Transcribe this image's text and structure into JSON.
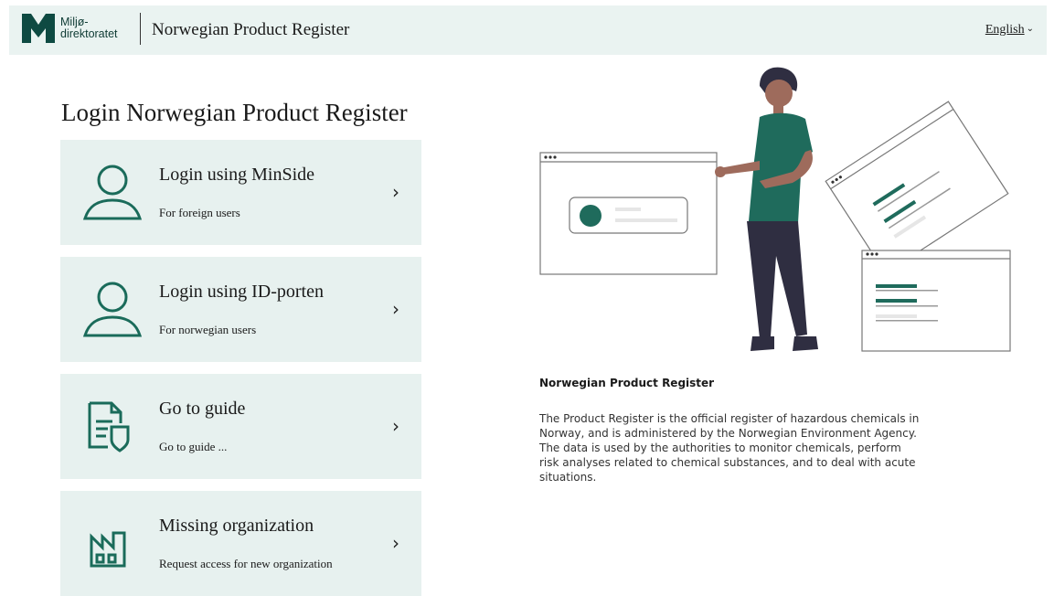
{
  "header": {
    "logo_line1": "Miljø-",
    "logo_line2": "direktoratet",
    "app_title": "Norwegian Product Register",
    "language": "English"
  },
  "main": {
    "page_title": "Login Norwegian Product Register",
    "cards": [
      {
        "title": "Login using MinSide",
        "subtitle": "For foreign users",
        "icon": "user-icon"
      },
      {
        "title": "Login using ID-porten",
        "subtitle": "For norwegian users",
        "icon": "user-icon"
      },
      {
        "title": "Go to guide",
        "subtitle": "Go to guide ...",
        "icon": "document-shield-icon"
      },
      {
        "title": "Missing organization",
        "subtitle": "Request access for new organization",
        "icon": "factory-icon"
      }
    ]
  },
  "info": {
    "title": "Norwegian Product Register",
    "text": "The Product Register is the official register of hazardous chemicals in Norway, and is administered by the Norwegian Environment Agency. The data is used by the authorities to monitor chemicals, perform risk analyses related to chemical substances, and to deal with acute situations."
  },
  "colors": {
    "accent": "#1a6b5a",
    "card_bg": "#e7f1ef",
    "header_bg": "#eaf3f1",
    "logo": "#0e4a42"
  }
}
